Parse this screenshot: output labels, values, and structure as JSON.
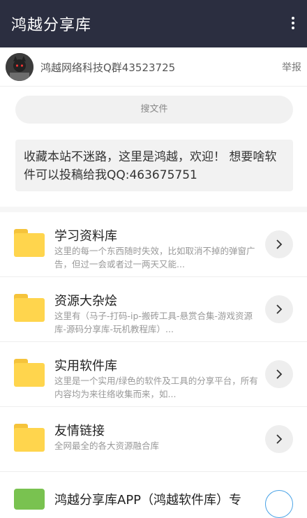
{
  "header": {
    "title": "鸿越分享库",
    "menu_icon": "more-vert-icon"
  },
  "owner": {
    "name": "鸿越网络科技Q群43523725",
    "report": "举报"
  },
  "search": {
    "label": "搜文件"
  },
  "notice": {
    "text": "收藏本站不迷路，这里是鸿越，欢迎！ 想要啥软件可以投稿给我QQ:463675751"
  },
  "folders": [
    {
      "title": "学习资料库",
      "desc": "这里的每一个东西随时失效，比如取消不掉的弹窗广告，但过一会或者过一两天又能..."
    },
    {
      "title": "资源大杂烩",
      "desc": "这里有（马子-打码-ip-搬砖工具-悬赏合集-游戏资源库-源码分享库-玩机教程库）..."
    },
    {
      "title": "实用软件库",
      "desc": "这里是一个实用/绿色的软件及工具的分享平台，所有内容均为来往络收集而来，如..."
    },
    {
      "title": "友情链接",
      "desc": "全网最全的各大资源融合库"
    }
  ],
  "app": {
    "title": "鸿越分享库APP（鸿越软件库）专"
  },
  "colors": {
    "topbar": "#2b2e40",
    "folder": "#ffd54d",
    "app_icon": "#79c250"
  }
}
